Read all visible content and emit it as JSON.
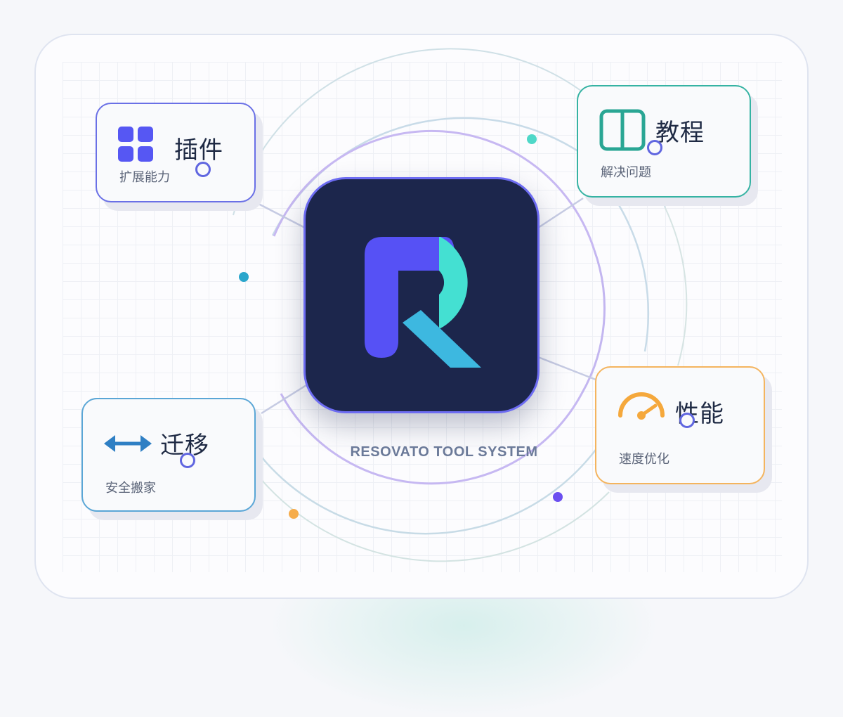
{
  "brand": {
    "caption": "RESOVATO TOOL SYSTEM",
    "logo_letter": "R",
    "colors": {
      "tile": "#1c264c",
      "purple": "#5651f5",
      "teal": "#44e0d2",
      "cyan": "#3db8e0"
    }
  },
  "cards": {
    "plugins": {
      "title": "插件",
      "subtitle": "扩展能力",
      "icon": "grid-icon",
      "color": "#6a70e6"
    },
    "tutorials": {
      "title": "教程",
      "subtitle": "解决问题",
      "icon": "book-icon",
      "color": "#36b3a3"
    },
    "migration": {
      "title": "迁移",
      "subtitle": "安全搬家",
      "icon": "double-arrow-icon",
      "color": "#5aa6d6"
    },
    "performance": {
      "title": "性能",
      "subtitle": "速度优化",
      "icon": "speedometer-icon",
      "color": "#f4b45e"
    }
  }
}
